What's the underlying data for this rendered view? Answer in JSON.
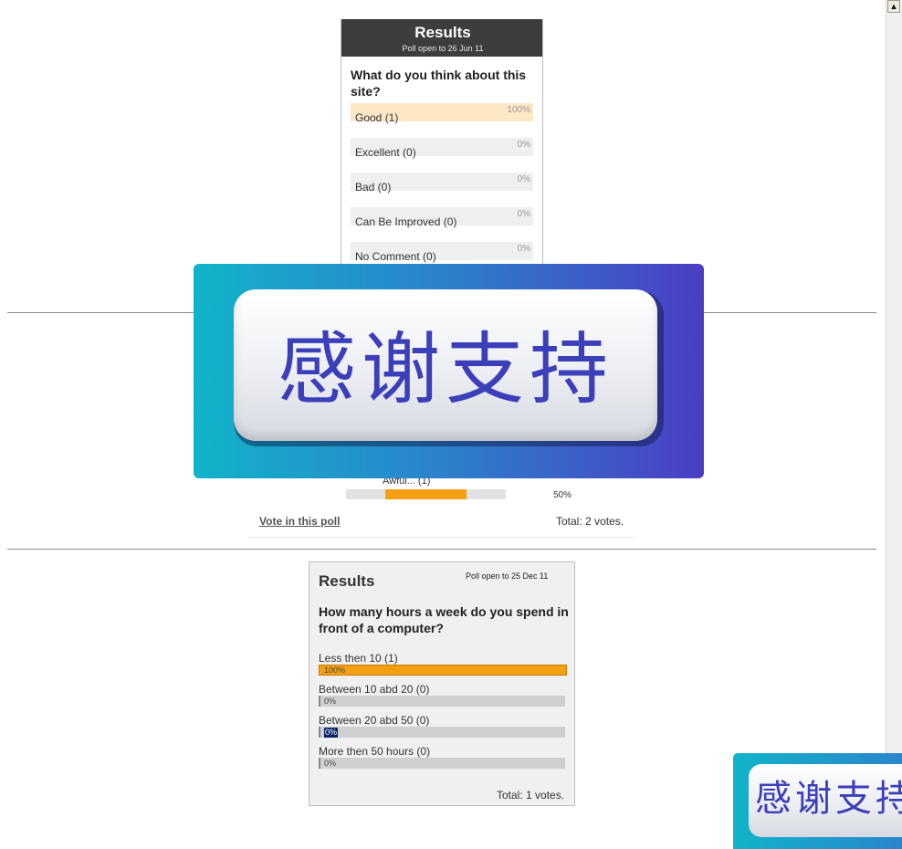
{
  "poll1": {
    "title": "Results",
    "subtitle": "Poll open to 26 Jun 11",
    "question": "What do you think about this site?",
    "options": [
      {
        "label": "Good (1)",
        "percent": "100%",
        "highlight": true
      },
      {
        "label": "Excellent (0)",
        "percent": "0%"
      },
      {
        "label": "Bad (0)",
        "percent": "0%"
      },
      {
        "label": "Can Be Improved (0)",
        "percent": "0%"
      },
      {
        "label": "No Comment (0)",
        "percent": "0%"
      }
    ]
  },
  "poll2": {
    "option_label": "Awful... (1)",
    "option_percent": "50%",
    "option_fill": 0.5,
    "vote_link": "Vote in this poll",
    "total": "Total: 2 votes."
  },
  "poll3": {
    "title": "Results",
    "open_until": "Poll open to 25 Dec 11",
    "question": "How many hours a week do you spend in front of a computer?",
    "options": [
      {
        "label": "Less then 10 (1)",
        "percent": "100%",
        "fill": 1.0
      },
      {
        "label": "Between 10 abd 20 (0)",
        "percent": "0%",
        "fill": 0
      },
      {
        "label": "Between 20 abd 50 (0)",
        "percent": "0%",
        "fill": 0,
        "selected": true
      },
      {
        "label": "More then 50 hours (0)",
        "percent": "0%",
        "fill": 0
      }
    ],
    "total": "Total: 1 votes."
  },
  "banner": {
    "text": "感谢支持"
  },
  "banner_small": {
    "text": "感谢支持"
  },
  "colors": {
    "accent": "#f4a012",
    "header": "#3d3d3d",
    "banner_text": "#3b3fb9"
  }
}
